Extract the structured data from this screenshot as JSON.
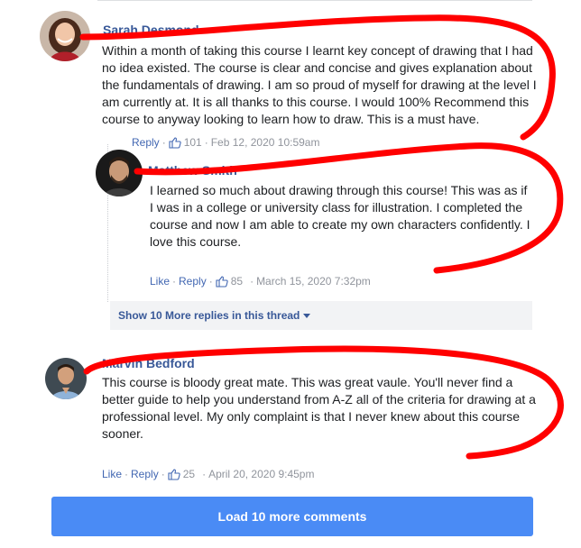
{
  "comments": [
    {
      "name": "Sarah Desmond",
      "text": "Within a month of taking this course I learnt key concept of drawing that I had no idea existed. The course is clear and concise and gives explanation about the fundamentals of drawing. I am so proud of myself for drawing at the level I am currently at. It is all thanks to this course. I would 100% Recommend this course to anyway looking to learn how to draw. This is a must have.",
      "reply_label": "Reply",
      "like_count": "101",
      "timestamp": "Feb 12, 2020 10:59am"
    },
    {
      "name": "Matthew Smith",
      "text": "I learned so much about drawing through this course! This was as if I was in a college or university class for illustration. I completed the course and now I am able to create my own characters confidently. I love this course.",
      "like_label": "Like",
      "reply_label": "Reply",
      "like_count": "85",
      "timestamp": "March 15, 2020 7:32pm"
    },
    {
      "name": "Marvin Bedford",
      "text": "This course is bloody great mate. This was great vaule. You'll never find a better guide to help you understand from A-Z all of the criteria for drawing at a professional level. My only complaint is that I never knew about this course sooner.",
      "like_label": "Like",
      "reply_label": "Reply",
      "like_count": "25",
      "timestamp": "April 20, 2020 9:45pm"
    }
  ],
  "thread": {
    "show_more_label": "Show 10 More replies in this thread"
  },
  "load_more_label": "Load 10 more comments",
  "separator": "·",
  "icons": {
    "like": "thumbs-up-icon",
    "dropdown": "caret-down-icon"
  },
  "colors": {
    "name_link": "#385898",
    "action_link": "#4267b2",
    "button": "#4a8bf5",
    "annotation": "#ff0000"
  }
}
